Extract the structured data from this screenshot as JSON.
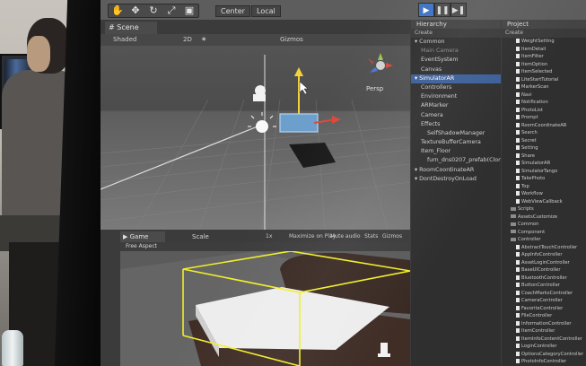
{
  "toolbar": {
    "pivot_label": "Center",
    "space_label": "Local"
  },
  "scene": {
    "tab_label": "Scene",
    "shading_mode": "Shaded",
    "mode_2d": "2D",
    "gizmos_label": "Gizmos",
    "persp_label": "Persp"
  },
  "game": {
    "tab_label": "Game",
    "aspect_label": "Free Aspect",
    "scale_label": "Scale",
    "scale_value": "1x",
    "options": [
      "Maximize on Play",
      "Mute audio",
      "Stats",
      "Gizmos"
    ]
  },
  "hierarchy": {
    "title": "Hierarchy",
    "create_label": "Create",
    "items": [
      {
        "label": "Common",
        "indent": 0,
        "state": "normal"
      },
      {
        "label": "Main Camera",
        "indent": 1,
        "state": "dim"
      },
      {
        "label": "EventSystem",
        "indent": 1,
        "state": "normal"
      },
      {
        "label": "Canvas",
        "indent": 1,
        "state": "normal"
      },
      {
        "label": "SimulatorAR",
        "indent": 0,
        "state": "selected"
      },
      {
        "label": "Controllers",
        "indent": 1,
        "state": "normal"
      },
      {
        "label": "Environment",
        "indent": 1,
        "state": "normal"
      },
      {
        "label": "ARMarker",
        "indent": 1,
        "state": "normal"
      },
      {
        "label": "Camera",
        "indent": 1,
        "state": "normal"
      },
      {
        "label": "Effects",
        "indent": 1,
        "state": "normal"
      },
      {
        "label": "SelfShadowManager",
        "indent": 2,
        "state": "normal"
      },
      {
        "label": "TextureBufferCamera",
        "indent": 1,
        "state": "normal"
      },
      {
        "label": "Item_Floor",
        "indent": 1,
        "state": "normal"
      },
      {
        "label": "furn_dns0207_prefab(Clone)",
        "indent": 2,
        "state": "normal"
      },
      {
        "label": "RoomCoordinateAR",
        "indent": 0,
        "state": "normal"
      },
      {
        "label": "DontDestroyOnLoad",
        "indent": 0,
        "state": "normal"
      }
    ]
  },
  "project": {
    "title": "Project",
    "create_label": "Create",
    "items": [
      {
        "label": "WeightSetting",
        "kind": "file"
      },
      {
        "label": "ItemDetail",
        "kind": "file"
      },
      {
        "label": "ItemFilter",
        "kind": "file"
      },
      {
        "label": "ItemOption",
        "kind": "file"
      },
      {
        "label": "ItemSelected",
        "kind": "file"
      },
      {
        "label": "LiteStartTutorial",
        "kind": "file"
      },
      {
        "label": "MarkerScan",
        "kind": "file"
      },
      {
        "label": "Navi",
        "kind": "file"
      },
      {
        "label": "Notification",
        "kind": "file"
      },
      {
        "label": "PhotoList",
        "kind": "file"
      },
      {
        "label": "Prompt",
        "kind": "file"
      },
      {
        "label": "RoomCoordinateAR",
        "kind": "file"
      },
      {
        "label": "Search",
        "kind": "file"
      },
      {
        "label": "Secret",
        "kind": "file"
      },
      {
        "label": "Setting",
        "kind": "file"
      },
      {
        "label": "Share",
        "kind": "file"
      },
      {
        "label": "SimulatorAR",
        "kind": "file"
      },
      {
        "label": "SimulatorTango",
        "kind": "file"
      },
      {
        "label": "TakePhoto",
        "kind": "file"
      },
      {
        "label": "Top",
        "kind": "file"
      },
      {
        "label": "Workflow",
        "kind": "file"
      },
      {
        "label": "WebViewCallback",
        "kind": "file"
      },
      {
        "label": "Scripts",
        "kind": "folder"
      },
      {
        "label": "AssetsCustomize",
        "kind": "folder"
      },
      {
        "label": "Common",
        "kind": "folder"
      },
      {
        "label": "Component",
        "kind": "folder"
      },
      {
        "label": "Controller",
        "kind": "folder"
      },
      {
        "label": "AbstractTouchController",
        "kind": "file"
      },
      {
        "label": "AppInfoController",
        "kind": "file"
      },
      {
        "label": "AssetLoginController",
        "kind": "file"
      },
      {
        "label": "BaseUIController",
        "kind": "file"
      },
      {
        "label": "BluetoothController",
        "kind": "file"
      },
      {
        "label": "ButtonController",
        "kind": "file"
      },
      {
        "label": "CoachMarksController",
        "kind": "file"
      },
      {
        "label": "CameraController",
        "kind": "file"
      },
      {
        "label": "FavoriteController",
        "kind": "file"
      },
      {
        "label": "FileController",
        "kind": "file"
      },
      {
        "label": "InformationController",
        "kind": "file"
      },
      {
        "label": "ItemController",
        "kind": "file"
      },
      {
        "label": "ItemInfoContentController",
        "kind": "file"
      },
      {
        "label": "LoginController",
        "kind": "file"
      },
      {
        "label": "OptionsCategoryController",
        "kind": "file"
      },
      {
        "label": "PhotoInfoController",
        "kind": "file"
      }
    ]
  }
}
